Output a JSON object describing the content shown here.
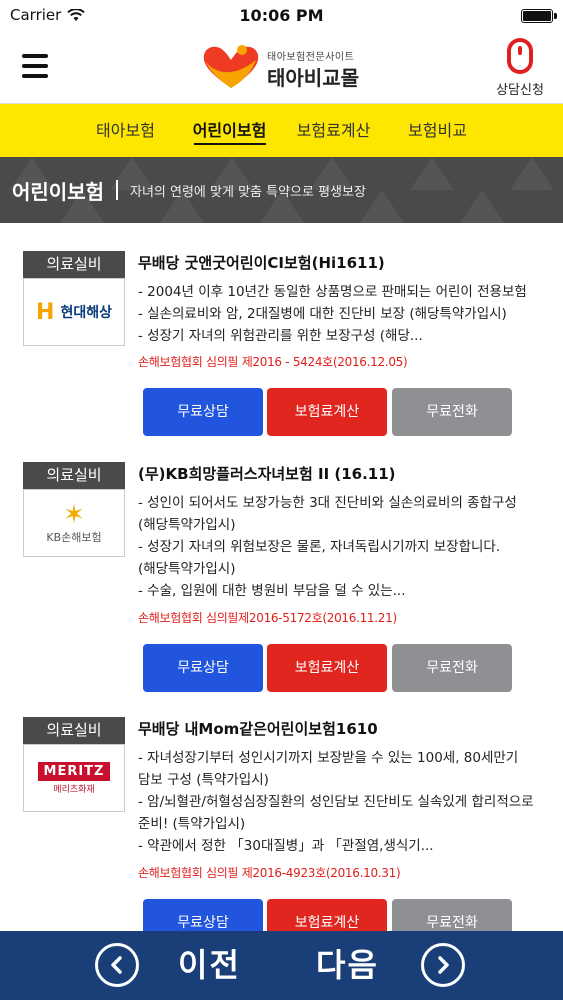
{
  "status_bar": {
    "carrier": "Carrier",
    "time": "10:06 PM"
  },
  "header": {
    "menu_icon": "hamburger-icon",
    "logo": {
      "subtitle": "태아보험전문사이트",
      "title": "태아비교몰"
    },
    "consult_label": "상담신청",
    "consult_icon": "mouse-icon"
  },
  "tabs": [
    {
      "label": "태아보험",
      "active": false
    },
    {
      "label": "어린이보험",
      "active": true
    },
    {
      "label": "보험료계산",
      "active": false
    },
    {
      "label": "보험비교",
      "active": false
    }
  ],
  "section": {
    "title": "어린이보험",
    "description": "자녀의 연령에 맞게 맞춤 특약으로 평생보장"
  },
  "products": [
    {
      "badge": "의료실비",
      "insurer": "현대해상",
      "title": "무배당 굿앤굿어린이CI보험(Hi1611)",
      "description": [
        "- 2004년 이후 10년간 동일한 상품명으로 판매되는 어린이 전용보험",
        "- 실손의료비와 암, 2대질병에 대한 진단비 보장 (해당특약가입시)",
        "- 성장기 자녀의 위험관리를 위한 보장구성 (해당..."
      ],
      "review": "손해보험협회 심의필 제2016 - 5424호(2016.12.05)",
      "buttons": {
        "consult": "무료상담",
        "calc": "보험료계산",
        "call": "무료전화"
      }
    },
    {
      "badge": "의료실비",
      "insurer": "KB손해보험",
      "title": "(무)KB희망플러스자녀보험 II (16.11)",
      "description": [
        "- 성인이 되어서도 보장가능한 3대 진단비와 실손의료비의 종합구성 (해당특약가입시)",
        "- 성장기 자녀의 위험보장은 물론, 자녀독립시기까지 보장합니다. (해당특약가입시)",
        "- 수술, 입원에 대한 병원비 부담을 덜 수 있는..."
      ],
      "review": "손해보험협회 심의필제2016-5172호(2016.11.21)",
      "buttons": {
        "consult": "무료상담",
        "calc": "보험료계산",
        "call": "무료전화"
      }
    },
    {
      "badge": "의료실비",
      "insurer": "MERITZ",
      "insurer_sub": "메리츠화재",
      "title": "무배당 내Mom같은어린이보험1610",
      "description": [
        "- 자녀성장기부터 성인시기까지 보장받을 수 있는 100세, 80세만기 담보 구성 (특약가입시)",
        "- 암/뇌혈관/허혈성심장질환의 성인담보 진단비도 실속있게 합리적으로 준비! (특약가입시)",
        "- 약관에서 정한 「30대질병」과 「관절염,생식기..."
      ],
      "review": "손해보험협회 심의필 제2016-4923호(2016.10.31)",
      "buttons": {
        "consult": "무료상담",
        "calc": "보험료계산",
        "call": "무료전화"
      }
    }
  ],
  "bottom_nav": {
    "prev": "이전",
    "next": "다음",
    "prev_icon": "chevron-left-icon",
    "next_icon": "chevron-right-icon"
  },
  "colors": {
    "tab_bar": "#fde700",
    "banner": "#4a4a4a",
    "blue_button": "#2255dd",
    "red_button": "#e0261f",
    "gray_button": "#8e9094",
    "review_text": "#e0201c",
    "bottom_nav": "#1a3e78"
  }
}
